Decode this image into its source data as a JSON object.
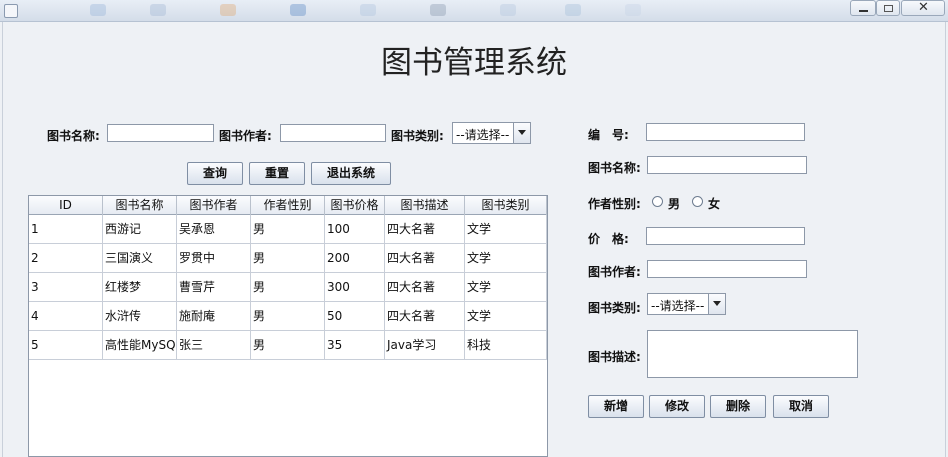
{
  "title": "图书管理系统",
  "search": {
    "name_label": "图书名称:",
    "author_label": "图书作者:",
    "category_label": "图书类别:",
    "category_selected": "--请选择--",
    "query_button": "查询",
    "reset_button": "重置",
    "exit_button": "退出系统"
  },
  "table": {
    "columns": [
      "ID",
      "图书名称",
      "图书作者",
      "作者性别",
      "图书价格",
      "图书描述",
      "图书类别"
    ],
    "rows": [
      [
        "1",
        "西游记",
        "吴承恩",
        "男",
        "100",
        "四大名著",
        "文学"
      ],
      [
        "2",
        "三国演义",
        "罗贯中",
        "男",
        "200",
        "四大名著",
        "文学"
      ],
      [
        "3",
        "红楼梦",
        "曹雪芹",
        "男",
        "300",
        "四大名著",
        "文学"
      ],
      [
        "4",
        "水浒传",
        "施耐庵",
        "男",
        "50",
        "四大名著",
        "文学"
      ],
      [
        "5",
        "高性能MySQL",
        "张三",
        "男",
        "35",
        "Java学习",
        "科技"
      ]
    ]
  },
  "form": {
    "id_label": "编　号:",
    "name_label": "图书名称:",
    "sex_label": "作者性别:",
    "sex_male": "男",
    "sex_female": "女",
    "price_label": "价　格:",
    "author_label": "图书作者:",
    "category_label": "图书类别:",
    "category_selected": "--请选择--",
    "desc_label": "图书描述:",
    "add_button": "新增",
    "modify_button": "修改",
    "delete_button": "删除",
    "cancel_button": "取消"
  }
}
